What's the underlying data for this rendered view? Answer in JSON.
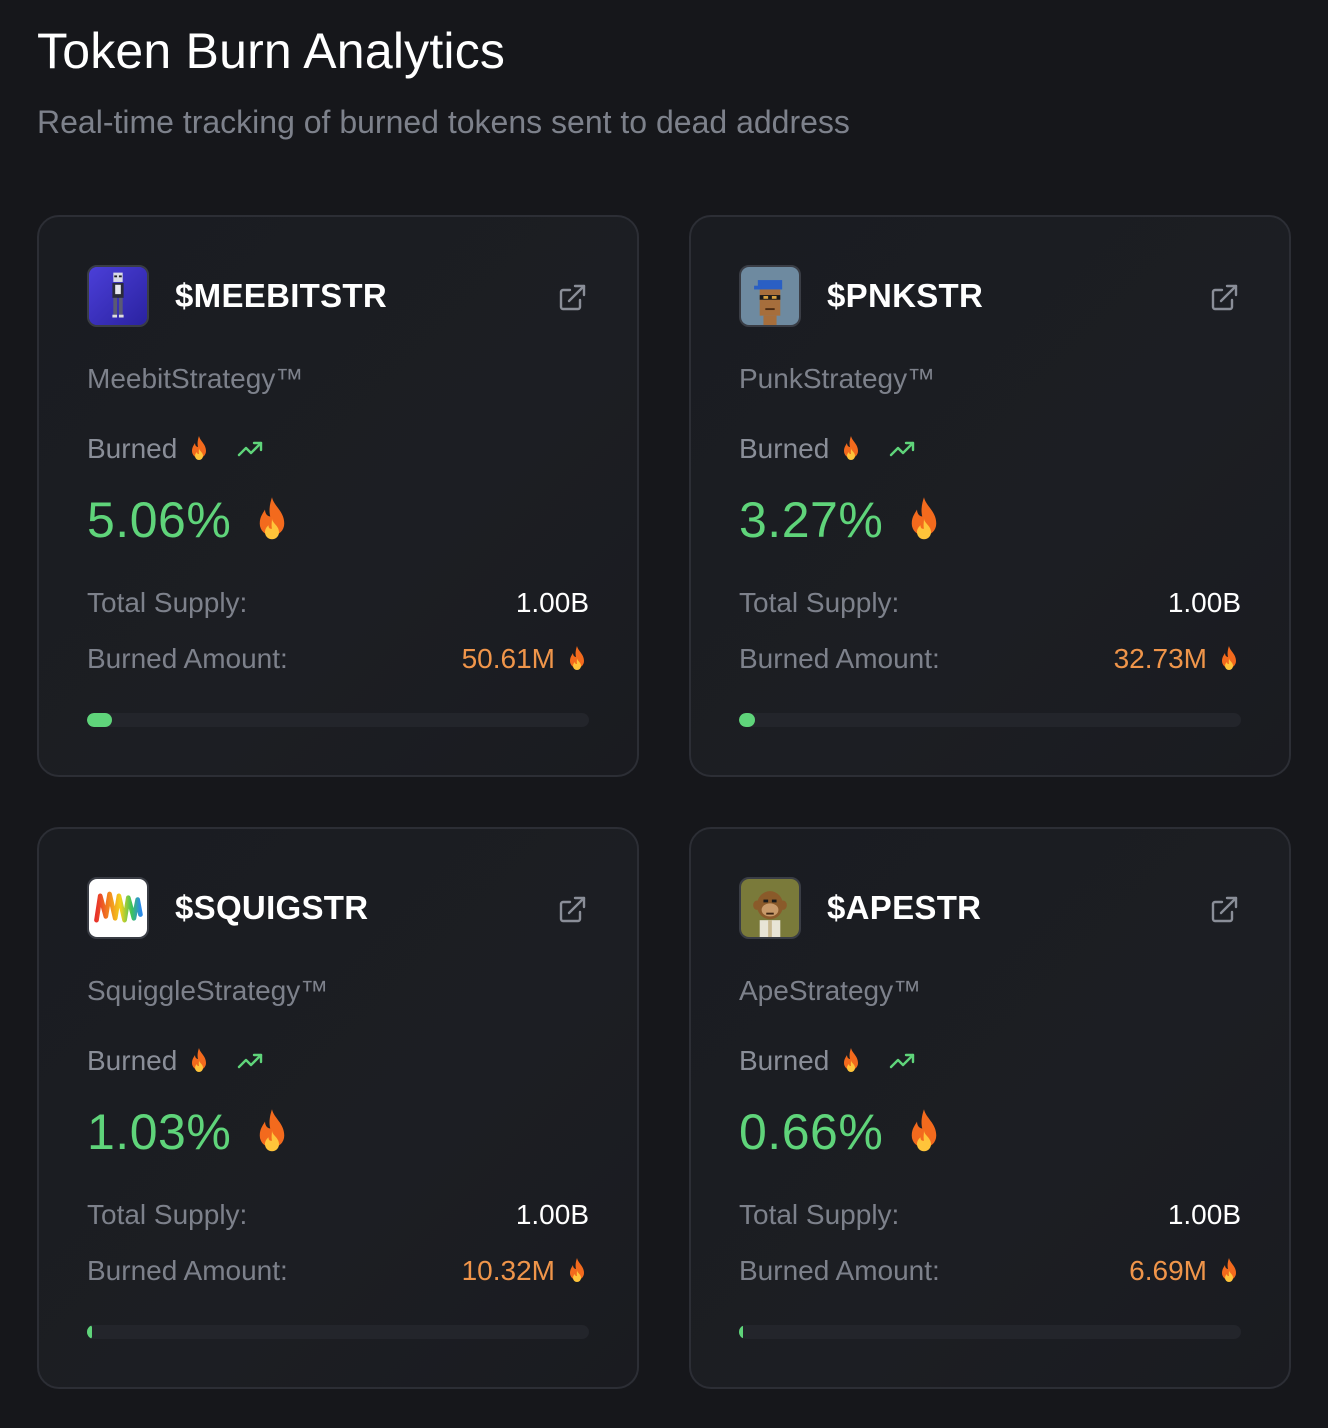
{
  "header": {
    "title": "Token Burn Analytics",
    "subtitle": "Real-time tracking of burned tokens sent to dead address"
  },
  "colors": {
    "background": "#16171b",
    "card_border": "#2c2e35",
    "percent_green": "#5fd47a",
    "burned_orange": "#f0954a",
    "muted_text": "#7d818b"
  },
  "tokens": [
    {
      "symbol": "$MEEBITSTR",
      "name": "MeebitStrategy™",
      "burned_label": "Burned",
      "burn_percent": "5.06%",
      "supply_label": "Total Supply:",
      "total_supply": "1.00B",
      "amount_label": "Burned Amount:",
      "burned_amount": "50.61M",
      "progress_fraction": 0.0506,
      "avatar_icon": "meebit-avatar-icon"
    },
    {
      "symbol": "$PNKSTR",
      "name": "PunkStrategy™",
      "burned_label": "Burned",
      "burn_percent": "3.27%",
      "supply_label": "Total Supply:",
      "total_supply": "1.00B",
      "amount_label": "Burned Amount:",
      "burned_amount": "32.73M",
      "progress_fraction": 0.0327,
      "avatar_icon": "punk-avatar-icon"
    },
    {
      "symbol": "$SQUIGSTR",
      "name": "SquiggleStrategy™",
      "burned_label": "Burned",
      "burn_percent": "1.03%",
      "supply_label": "Total Supply:",
      "total_supply": "1.00B",
      "amount_label": "Burned Amount:",
      "burned_amount": "10.32M",
      "progress_fraction": 0.0103,
      "avatar_icon": "squiggle-avatar-icon"
    },
    {
      "symbol": "$APESTR",
      "name": "ApeStrategy™",
      "burned_label": "Burned",
      "burn_percent": "0.66%",
      "supply_label": "Total Supply:",
      "total_supply": "1.00B",
      "amount_label": "Burned Amount:",
      "burned_amount": "6.69M",
      "progress_fraction": 0.0066,
      "avatar_icon": "ape-avatar-icon"
    }
  ]
}
